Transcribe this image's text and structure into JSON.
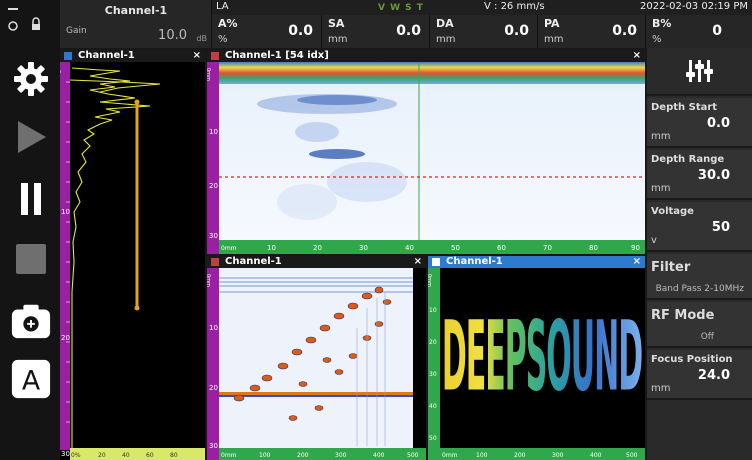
{
  "status": {
    "datetime": "2022-02-03 02:19 PM",
    "wave_letters": "V W S T",
    "velocity": "V : 26 mm/s"
  },
  "header": {
    "channel": "Channel-1",
    "gain_label": "Gain",
    "gain_value": "10.0",
    "gain_unit": "dB",
    "la_label": "LA",
    "measurements": [
      {
        "label": "A%",
        "unit": "%",
        "value": "0.0"
      },
      {
        "label": "SA",
        "unit": "mm",
        "value": "0.0"
      },
      {
        "label": "DA",
        "unit": "mm",
        "value": "0.0"
      },
      {
        "label": "PA",
        "unit": "mm",
        "value": "0.0"
      },
      {
        "label": "B%",
        "unit": "%",
        "value": "0"
      }
    ]
  },
  "panels": {
    "ascan_title": "Channel-1",
    "bscan_title": "Channel-1 [54 idx]",
    "sector_title": "Channel-1",
    "cscan_title": "Channel-1",
    "close_glyph": "×",
    "ruler_unit_mm": "0mm",
    "ruler_unit_pct": "0%",
    "cscan_text": "DEEPSOUND"
  },
  "ticks": {
    "depth_left": [
      "10",
      "20",
      "30"
    ],
    "bscan_x": [
      "10",
      "20",
      "30",
      "40",
      "50",
      "60",
      "70",
      "80",
      "90"
    ],
    "bscan_y": [
      "10",
      "20",
      "30"
    ],
    "pct": [
      "20",
      "40",
      "60",
      "80"
    ],
    "sector_x": [
      "100",
      "200",
      "300",
      "400",
      "500"
    ],
    "sector_y": [
      "10",
      "20",
      "30"
    ],
    "cscan_y": [
      "10",
      "20",
      "30",
      "40",
      "50"
    ],
    "cscan_x": [
      "100",
      "200",
      "300",
      "400",
      "500"
    ]
  },
  "right_panel": {
    "depth_start": {
      "label": "Depth Start",
      "unit": "mm",
      "value": "0.0"
    },
    "depth_range": {
      "label": "Depth Range",
      "unit": "mm",
      "value": "30.0"
    },
    "voltage": {
      "label": "Voltage",
      "unit": "v",
      "value": "50"
    },
    "filter": {
      "label": "Filter",
      "value": "Band Pass 2-10MHz"
    },
    "rf_mode": {
      "label": "RF Mode",
      "value": "Off"
    },
    "focus": {
      "label": "Focus Position",
      "unit": "mm",
      "value": "24.0"
    }
  },
  "toolbar_icons": [
    "settings-icon",
    "play-icon",
    "pause-icon",
    "stop-icon",
    "camera-icon",
    "auto-icon"
  ],
  "toolbar_auto_letter": "A",
  "colors": {
    "accent_blue": "#2d7bd1",
    "ruler_purple": "#9b1fa3",
    "ruler_green": "#2ea84a",
    "trace_yellow": "#e8e83a",
    "gate_orange": "#e8a020",
    "gate_red": "#e02020"
  }
}
